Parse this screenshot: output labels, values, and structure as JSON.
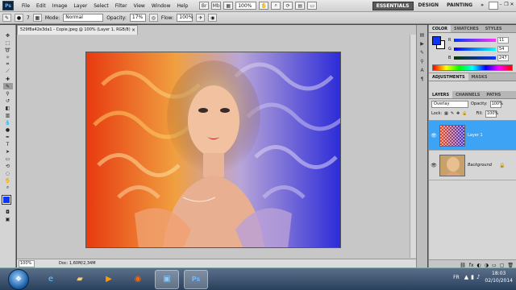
{
  "app": {
    "logo": "Ps",
    "menus": [
      "File",
      "Edit",
      "Image",
      "Layer",
      "Select",
      "Filter",
      "View",
      "Window",
      "Help"
    ],
    "zoom": "100%",
    "workspaces": [
      "ESSENTIALS",
      "DESIGN",
      "PAINTING",
      "»"
    ],
    "active_workspace": "ESSENTIALS"
  },
  "options": {
    "brush_size": "7",
    "mode_label": "Mode:",
    "mode_value": "Normal",
    "opacity_label": "Opacity:",
    "opacity_value": "17%",
    "flow_label": "Flow:",
    "flow_value": "100%"
  },
  "document": {
    "tab_title": "529f8a42e3da1 - Copie.jpeg @ 100% (Layer 1, RGB/8)",
    "zoom_status": "100%",
    "doc_info": "Doc: 1,60M/2,34M"
  },
  "color_panel": {
    "tabs": [
      "COLOR",
      "SWATCHES",
      "STYLES"
    ],
    "r": "11",
    "g": "54",
    "b": "247",
    "fg_color": "#0b36f7",
    "bg_color": "#ffffff"
  },
  "adjustments": {
    "tabs": [
      "ADJUSTMENTS",
      "MASKS"
    ]
  },
  "layers_panel": {
    "tabs": [
      "LAYERS",
      "CHANNELS",
      "PATHS"
    ],
    "blend_mode": "Overlay",
    "opacity_label": "Opacity:",
    "opacity_value": "100%",
    "lock_label": "Lock:",
    "fill_label": "Fill:",
    "fill_value": "100%",
    "layers": [
      {
        "name": "Layer 1",
        "selected": true
      },
      {
        "name": "Background",
        "selected": false,
        "locked": true
      }
    ]
  },
  "taskbar": {
    "language": "FR",
    "time": "18:03",
    "date": "02/10/2014"
  }
}
